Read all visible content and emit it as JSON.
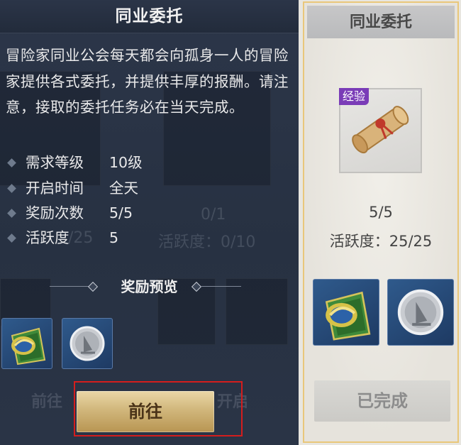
{
  "popup": {
    "title": "同业委托",
    "description": "冒险家同业公会每天都会向孤身一人的冒险家提供各式委托，并提供丰厚的报酬。请注意，接取的委托任务必在当天完成。",
    "info": [
      {
        "label": "需求等级",
        "value": "10级"
      },
      {
        "label": "开启时间",
        "value": "全天"
      },
      {
        "label": "奖励次数",
        "value": "5/5"
      },
      {
        "label": "活跃度",
        "value": "5"
      }
    ],
    "reward_title": "奖励预览",
    "reward_items": [
      "guild-ticket-icon",
      "silver-coin-icon"
    ],
    "go_button": "前往"
  },
  "background": {
    "progress": "0/1",
    "activity_left": "/25",
    "activity_mid": "活跃度：0/10",
    "btn_left": "前往",
    "btn_mid": "开启"
  },
  "card": {
    "title": "同业委托",
    "reward_badge": "经验",
    "reward_icon": "scroll-icon",
    "count": "5/5",
    "activity": "活跃度：25/25",
    "items": [
      "guild-ticket-icon",
      "silver-coin-icon"
    ],
    "done_button": "已完成"
  },
  "colors": {
    "accent_gold": "#d1b77c",
    "highlight_red": "#d41d1d",
    "exp_purple": "#7a3cb7",
    "card_border": "#e9c77a"
  }
}
